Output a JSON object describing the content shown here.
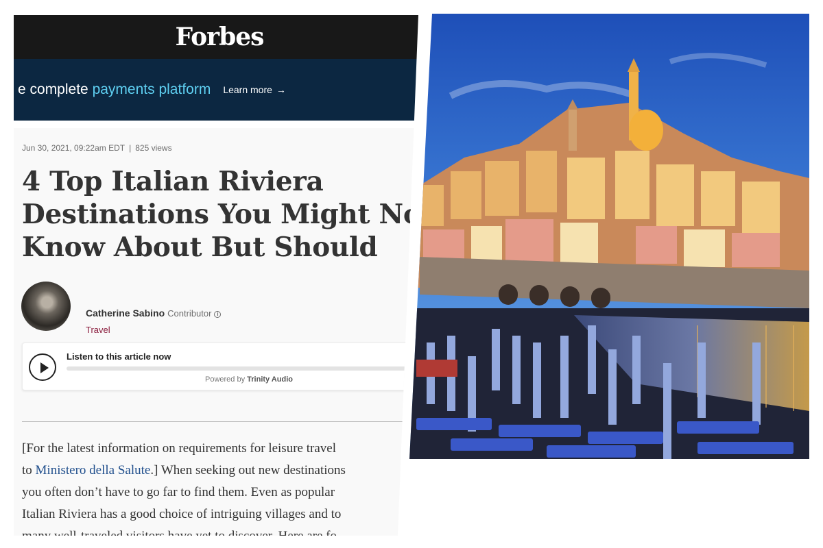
{
  "header": {
    "logo": "Forbes"
  },
  "ad": {
    "text_plain": "e complete",
    "text_accent": "payments platform",
    "cta": "Learn more",
    "cta_arrow": "→"
  },
  "article": {
    "date": "Jun 30, 2021, 09:22am EDT",
    "separator": "|",
    "views": "825 views",
    "headline_lines": [
      "4 Top Italian Riviera",
      "Destinations You Might Not",
      "Know About But Should"
    ],
    "author": {
      "name": "Catherine Sabino",
      "role": "Contributor",
      "info_icon": "i",
      "category": "Travel"
    },
    "audio": {
      "label": "Listen to this article now",
      "powered_prefix": "Powered by",
      "powered_brand": "Trinity Audio"
    },
    "body": {
      "line1": "[For the latest information on requirements for leisure travel",
      "line2_pre": "to ",
      "line2_link": "Ministero della Salute",
      "line2_post": ".] When seeking out new destinations",
      "line3": "you often don’t have to go far to find them. Even as popular",
      "line4": "Italian Riviera has a good choice of intriguing villages and to",
      "line5": "many well-traveled visitors have yet to discover. Here are fo"
    }
  },
  "colors": {
    "forbes_bar": "#181818",
    "ad_background": "#0c2741",
    "ad_accent": "#5fd0f2",
    "category": "#8a1c3d",
    "link": "#1f4e8c"
  }
}
